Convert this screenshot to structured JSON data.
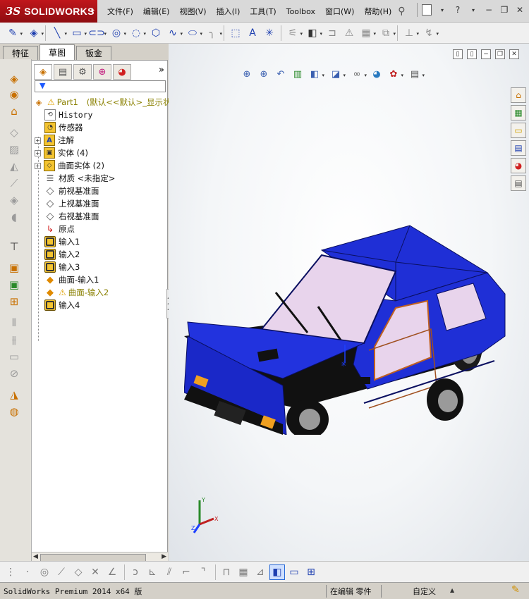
{
  "app": {
    "logo_ds": "3S",
    "logo_text": "SOLIDWORKS",
    "menus": [
      "文件(F)",
      "编辑(E)",
      "视图(V)",
      "插入(I)",
      "工具(T)",
      "Toolbox",
      "窗口(W)",
      "帮助(H)"
    ],
    "help_label": "?"
  },
  "tabs": [
    "特征",
    "草图",
    "钣金"
  ],
  "tree": {
    "root": "Part1",
    "root_config": "(默认<<默认>_显示状",
    "history": "History",
    "sensors": "传感器",
    "annotations": "注解",
    "solid_bodies": "实体 (4)",
    "surface_bodies": "曲面实体 (2)",
    "material": "材质 <未指定>",
    "front_plane": "前视基准面",
    "top_plane": "上视基准面",
    "right_plane": "右视基准面",
    "origin": "原点",
    "import1": "输入1",
    "import2": "输入2",
    "import3": "输入3",
    "surf_import1": "曲面-输入1",
    "surf_import2": "曲面-输入2",
    "import4": "输入4"
  },
  "status": {
    "version": "SolidWorks Premium 2014 x64 版",
    "editing": "在编辑 零件",
    "units": "自定义"
  },
  "colors": {
    "logo_red": "#c0161b",
    "car_body": "#1f2fd6",
    "car_window": "#f1d9ee",
    "toolbar_bg": "#f0f0f0"
  }
}
